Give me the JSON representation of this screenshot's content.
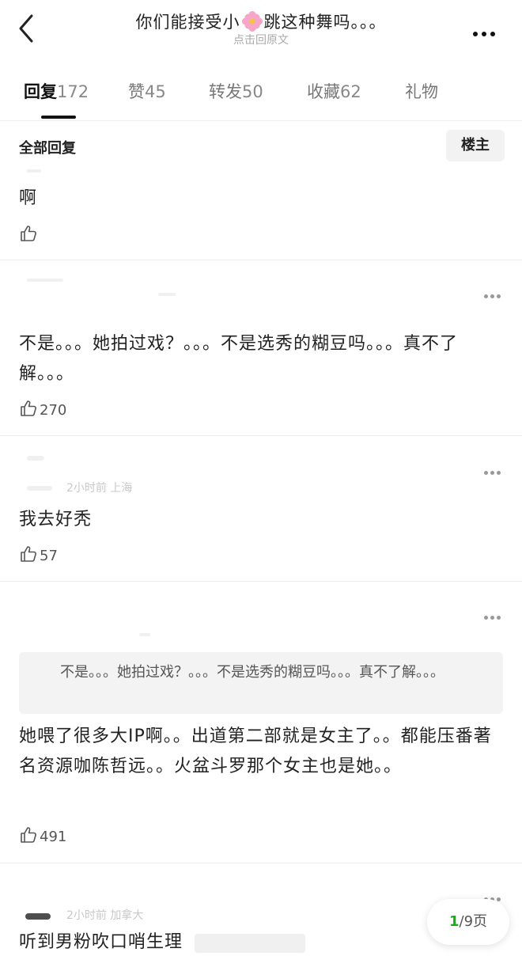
{
  "header": {
    "title_left": "你们能接受小",
    "title_right": "跳这种舞吗。。。",
    "subtitle": "点击回原文"
  },
  "tabs": [
    {
      "label": "回复",
      "count": "172"
    },
    {
      "label": "赞",
      "count": "45"
    },
    {
      "label": "转发",
      "count": "50"
    },
    {
      "label": "收藏",
      "count": "62"
    },
    {
      "label": "礼物",
      "count": ""
    }
  ],
  "filter": {
    "label": "全部回复",
    "owner_button": "楼主"
  },
  "comments": [
    {
      "text": "啊",
      "likes": ""
    },
    {
      "text": "不是。。。她拍过戏？。。。不是选秀的糊豆吗。。。真不了解。。。",
      "likes": "270"
    },
    {
      "meta": "2小时前 上海",
      "text": "我去好秃",
      "likes": "57"
    },
    {
      "quote": "不是。。。她拍过戏？。。。不是选秀的糊豆吗。。。真不了解。。。",
      "text": "她喂了很多大IP啊。。出道第二部就是女主了。。都能压番著名资源咖陈哲远。。火盆斗罗那个女主也是她。。",
      "likes": "491"
    },
    {
      "meta": "2小时前 加拿大",
      "text": "听到男粉吹口哨生理"
    }
  ],
  "pager": {
    "current": "1",
    "total": "/9页"
  },
  "colors": {
    "accent": "#1aad19",
    "text": "#222222",
    "muted": "#888888"
  },
  "icons": [
    "back-icon",
    "more-icon",
    "flower-emoji-icon",
    "thumb-up-icon",
    "comment-more-icon"
  ]
}
